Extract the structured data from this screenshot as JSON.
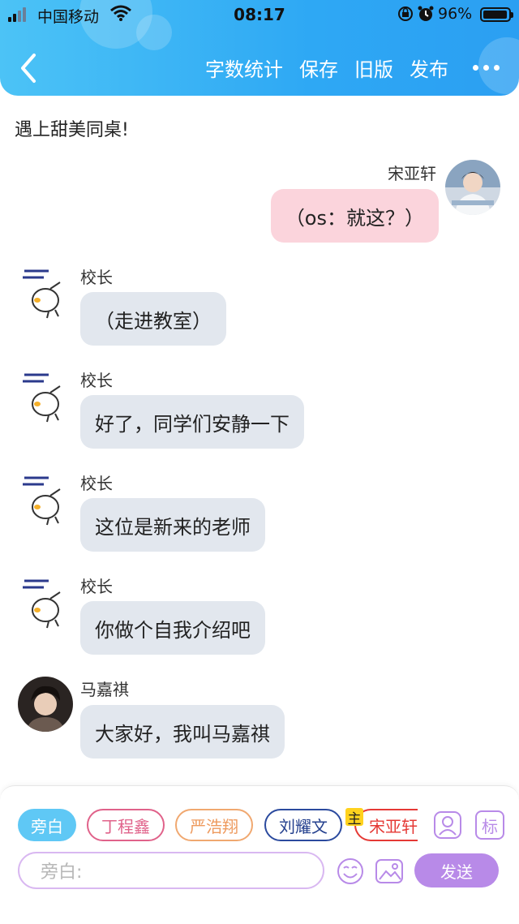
{
  "status_bar": {
    "carrier": "中国移动",
    "time": "08:17",
    "battery": "96%",
    "battery_level": 0.96
  },
  "header": {
    "actions": [
      "字数统计",
      "保存",
      "旧版",
      "发布"
    ]
  },
  "story": {
    "title": "遇上甜美同桌!"
  },
  "messages": [
    {
      "sender": "宋亚轩",
      "text": "（os：就这？）",
      "side": "right"
    },
    {
      "sender": "校长",
      "text": "（走进教室）",
      "side": "left"
    },
    {
      "sender": "校长",
      "text": "好了，同学们安静一下",
      "side": "left"
    },
    {
      "sender": "校长",
      "text": "这位是新来的老师",
      "side": "left"
    },
    {
      "sender": "校长",
      "text": "你做个自我介绍吧",
      "side": "left"
    },
    {
      "sender": "马嘉祺",
      "text": "大家好，我叫马嘉祺",
      "side": "left"
    }
  ],
  "composer": {
    "roles": [
      "旁白",
      "丁程鑫",
      "严浩翔",
      "刘耀文",
      "宋亚轩"
    ],
    "main_badge": "主",
    "tag_button": "标",
    "input_placeholder": "旁白:",
    "send_label": "发送"
  },
  "colors": {
    "header_blue": "#2ea8f4",
    "bubble_left": "#e2e7ee",
    "bubble_right": "#fbd4dc",
    "send_purple": "#b88ae8"
  }
}
